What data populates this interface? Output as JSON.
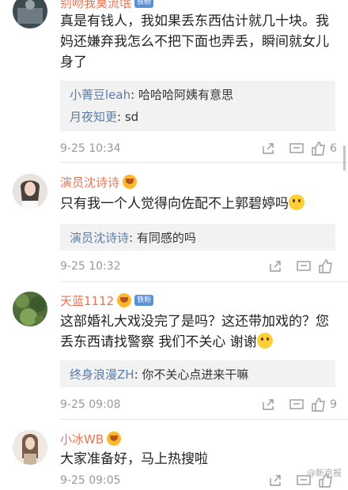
{
  "comments": [
    {
      "user": "别吻我莫流氓",
      "fan_badge": "铁粉",
      "text": "真是有钱人，我如果丢东西估计就几十块。我妈还嫌弃我怎么不把下面也弄丢，瞬间就女儿身了",
      "replies": [
        {
          "name": "小菁豆leah",
          "text": "哈哈哈阿姨有意思"
        },
        {
          "name": "月夜知更",
          "text": "sd"
        }
      ],
      "time": "9-25 10:34",
      "likes": "6"
    },
    {
      "user": "演员沈诗诗",
      "text": "只有我一个人觉得向佐配不上郭碧婷吗",
      "replies": [
        {
          "name": "演员沈诗诗",
          "text": "有同感的吗"
        }
      ],
      "time": "9-25 10:32",
      "likes": ""
    },
    {
      "user": "天蓝1112",
      "fan_badge": "铁粉",
      "text": "这部婚礼大戏没完了是吗？这还带加戏的？您丢东西请找警察 我们不关心 谢谢",
      "replies": [
        {
          "name": "终身浪漫ZH",
          "text": "你不关心点进来干嘛"
        }
      ],
      "time": "9-25 09:08",
      "likes": "9"
    },
    {
      "user": "小冰WB",
      "text": "大家准备好，马上热搜啦",
      "time": "9-25 09:05",
      "likes": ""
    }
  ],
  "watermark": "@新京报",
  "icons": {
    "share": "share-icon",
    "comment": "comment-icon",
    "like": "thumbs-up-icon"
  }
}
